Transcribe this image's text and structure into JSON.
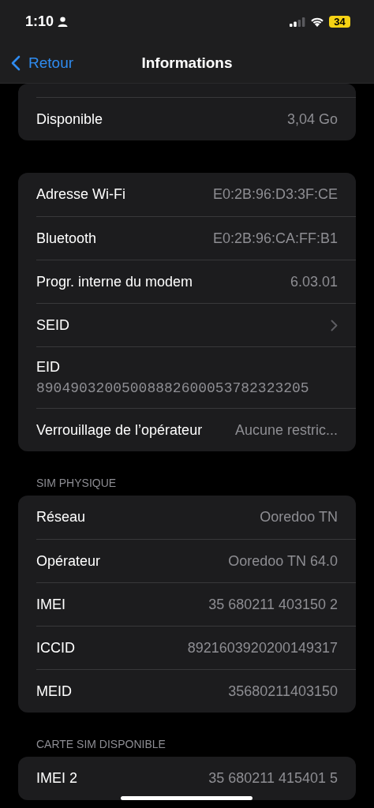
{
  "status_bar": {
    "time": "1:10",
    "battery": "34"
  },
  "nav": {
    "back": "Retour",
    "title": "Informations"
  },
  "sections": [
    {
      "rows": [
        {
          "kind": "value",
          "label": "Disponible",
          "value": "3,04 Go"
        }
      ]
    },
    {
      "rows": [
        {
          "kind": "value",
          "label": "Adresse Wi-Fi",
          "value": "E0:2B:96:D3:3F:CE"
        },
        {
          "kind": "value",
          "label": "Bluetooth",
          "value": "E0:2B:96:CA:FF:B1"
        },
        {
          "kind": "value",
          "label": "Progr. interne du modem",
          "value": "6.03.01"
        },
        {
          "kind": "chevron",
          "label": "SEID"
        },
        {
          "kind": "stacked",
          "label": "EID",
          "value": "89049032005008882600053782323205"
        },
        {
          "kind": "value",
          "label": "Verrouillage de l’opérateur",
          "value": "Aucune restric..."
        }
      ]
    },
    {
      "header": "SIM PHYSIQUE",
      "rows": [
        {
          "kind": "value",
          "label": "Réseau",
          "value": "Ooredoo TN"
        },
        {
          "kind": "value",
          "label": "Opérateur",
          "value": "Ooredoo TN 64.0"
        },
        {
          "kind": "value",
          "label": "IMEI",
          "value": "35 680211 403150 2"
        },
        {
          "kind": "value",
          "label": "ICCID",
          "value": "8921603920200149317"
        },
        {
          "kind": "value",
          "label": "MEID",
          "value": "35680211403150"
        }
      ]
    },
    {
      "header": "CARTE SIM DISPONIBLE",
      "rows": [
        {
          "kind": "value",
          "label": "IMEI 2",
          "value": "35 680211 415401 5"
        }
      ]
    }
  ]
}
